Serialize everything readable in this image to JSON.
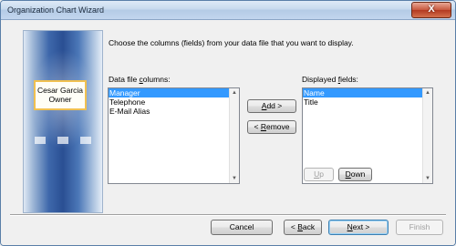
{
  "window": {
    "title": "Organization Chart Wizard",
    "close_glyph": "X"
  },
  "graphic": {
    "card_name": "Cesar Garcia",
    "card_role": "Owner"
  },
  "instruction": "Choose the columns (fields) from your data file that you want to display.",
  "left_list": {
    "label_prefix": "Data file ",
    "label_underline": "c",
    "label_suffix": "olumns:",
    "items": [
      "Manager",
      "Telephone",
      "E-Mail Alias"
    ],
    "selected_index": 0
  },
  "right_list": {
    "label_prefix": "Displayed ",
    "label_underline": "f",
    "label_suffix": "ields:",
    "items": [
      "Name",
      "Title"
    ],
    "selected_index": 0
  },
  "buttons": {
    "add": {
      "u": "A",
      "rest": "dd >"
    },
    "remove": {
      "pre": "< ",
      "u": "R",
      "rest": "emove"
    },
    "up": {
      "u": "U",
      "rest": "p"
    },
    "down": {
      "u": "D",
      "rest": "own"
    },
    "cancel": "Cancel",
    "back": {
      "pre": "< ",
      "u": "B",
      "rest": "ack"
    },
    "next": {
      "u": "N",
      "rest": "ext >"
    },
    "finish": "Finish"
  }
}
